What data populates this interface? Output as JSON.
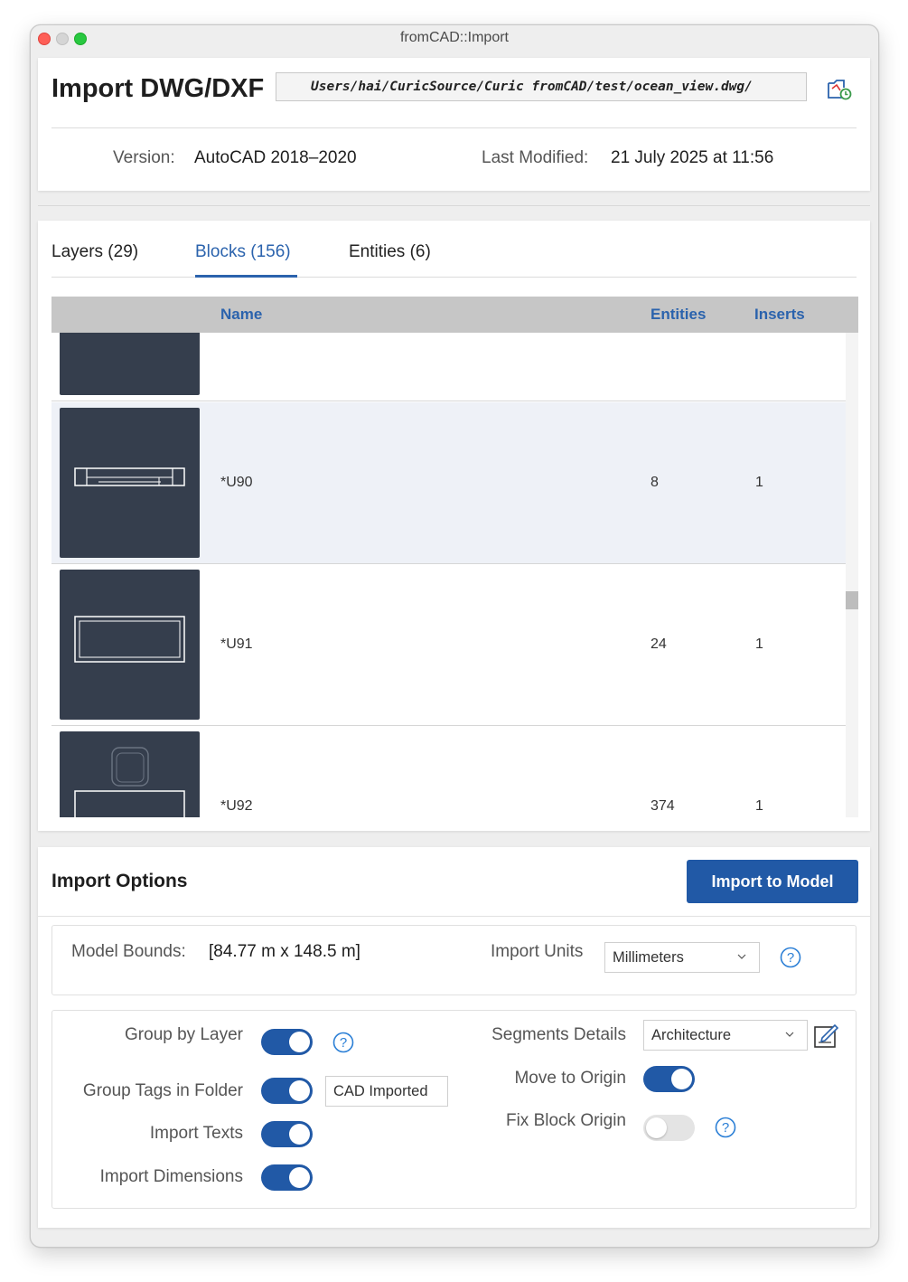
{
  "window": {
    "title": "fromCAD::Import"
  },
  "header": {
    "title": "Import DWG/DXF",
    "path": "Users/hai/CuricSource/Curic fromCAD/test/ocean_view.dwg/",
    "version_label": "Version:",
    "version_value": "AutoCAD 2018–2020",
    "modified_label": "Last Modified:",
    "modified_value": "21 July 2025 at 11:56"
  },
  "tabs": [
    {
      "label": "Layers (29)",
      "active": false
    },
    {
      "label": "Blocks (156)",
      "active": true
    },
    {
      "label": "Entities (6)",
      "active": false
    }
  ],
  "table": {
    "columns": {
      "name": "Name",
      "entities": "Entities",
      "inserts": "Inserts"
    },
    "rows": [
      {
        "name": "",
        "entities": "",
        "inserts": ""
      },
      {
        "name": "*U90",
        "entities": "8",
        "inserts": "1"
      },
      {
        "name": "*U91",
        "entities": "24",
        "inserts": "1"
      },
      {
        "name": "*U92",
        "entities": "374",
        "inserts": "1"
      }
    ]
  },
  "options": {
    "title": "Import Options",
    "import_button": "Import to Model",
    "model_bounds_label": "Model Bounds:",
    "model_bounds_value": "[84.77 m x 148.5 m]",
    "import_units_label": "Import Units",
    "import_units_value": "Millimeters",
    "group_by_layer_label": "Group by Layer",
    "group_by_layer": true,
    "group_tags_label": "Group Tags in Folder",
    "group_tags": true,
    "group_tags_folder": "CAD Imported",
    "import_texts_label": "Import Texts",
    "import_texts": true,
    "import_dimensions_label": "Import Dimensions",
    "import_dimensions": true,
    "segments_label": "Segments Details",
    "segments_value": "Architecture",
    "move_to_origin_label": "Move to Origin",
    "move_to_origin": true,
    "fix_block_origin_label": "Fix Block Origin",
    "fix_block_origin": false
  },
  "colors": {
    "accent": "#2159a6",
    "tab_active": "#2b63ad",
    "thumb_bg": "#353e4d"
  }
}
